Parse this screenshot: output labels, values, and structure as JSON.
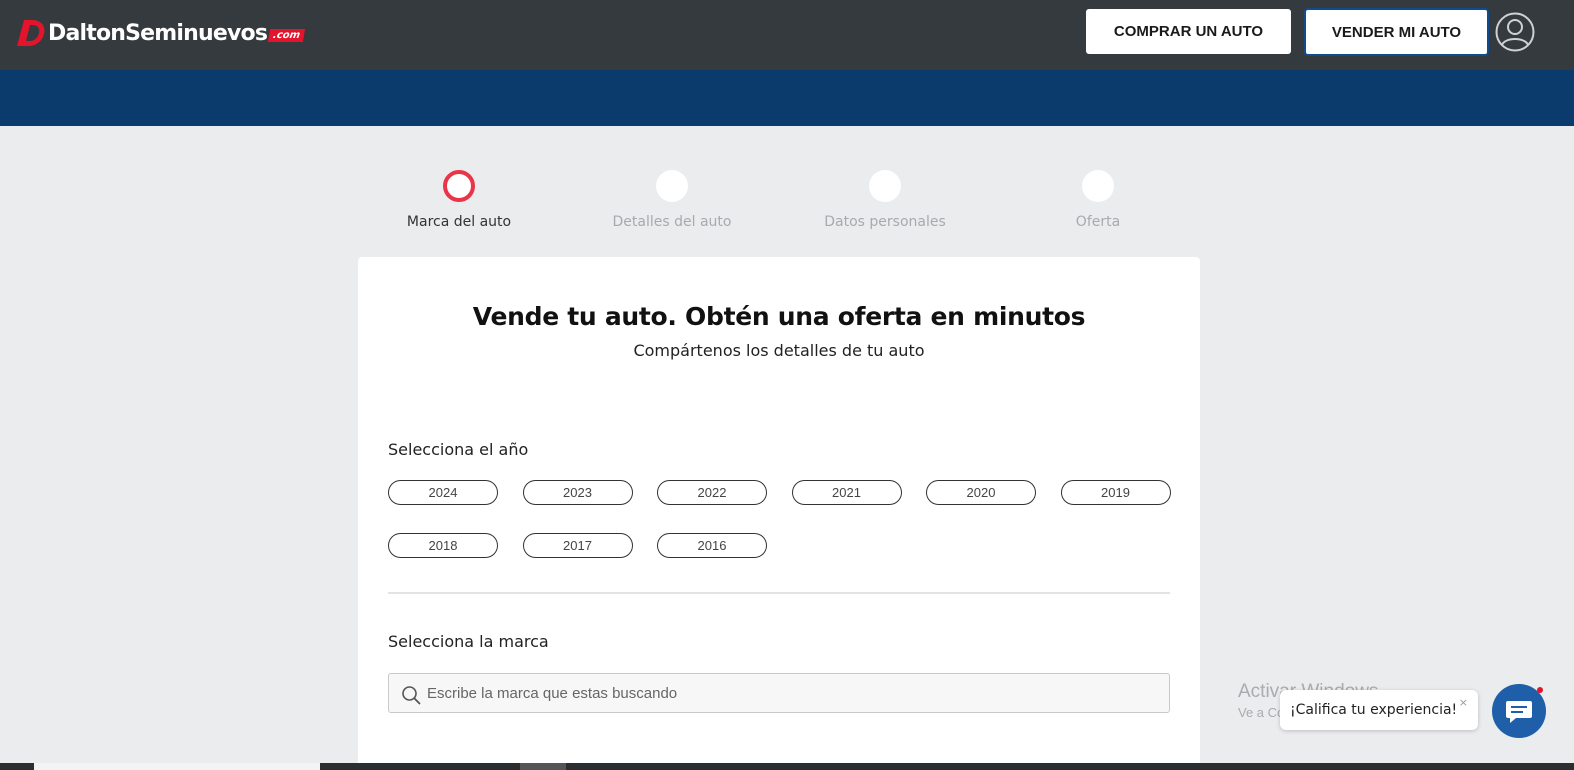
{
  "header": {
    "logo_text": "DaltonSeminuevos",
    "logo_suffix": ".com",
    "buy_label": "COMPRAR UN AUTO",
    "sell_label": "VENDER MI AUTO",
    "user_icon": "user-circle-icon"
  },
  "stepper": {
    "steps": [
      {
        "label": "Marca del auto",
        "active": true
      },
      {
        "label": "Detalles del auto",
        "active": false
      },
      {
        "label": "Datos personales",
        "active": false
      },
      {
        "label": "Oferta",
        "active": false
      }
    ]
  },
  "card": {
    "title": "Vende tu auto. Obtén una oferta en minutos",
    "subtitle": "Compártenos los detalles de tu auto",
    "year_section_label": "Selecciona el año",
    "years": [
      "2024",
      "2023",
      "2022",
      "2021",
      "2020",
      "2019",
      "2018",
      "2017",
      "2016"
    ],
    "brand_section_label": "Selecciona la marca",
    "search_placeholder": "Escribe la marca que estas buscando"
  },
  "watermark": {
    "title": "Activar Windows",
    "subtitle": "Ve a Configuración para activar Windows."
  },
  "feedback": {
    "rate_label": "¡Califica tu experiencia!",
    "close_label": "×"
  },
  "colors": {
    "topbar": "#343a3e",
    "bluebar": "#0b3a6d",
    "accent": "#ea3447",
    "chat": "#1f5ea8"
  }
}
